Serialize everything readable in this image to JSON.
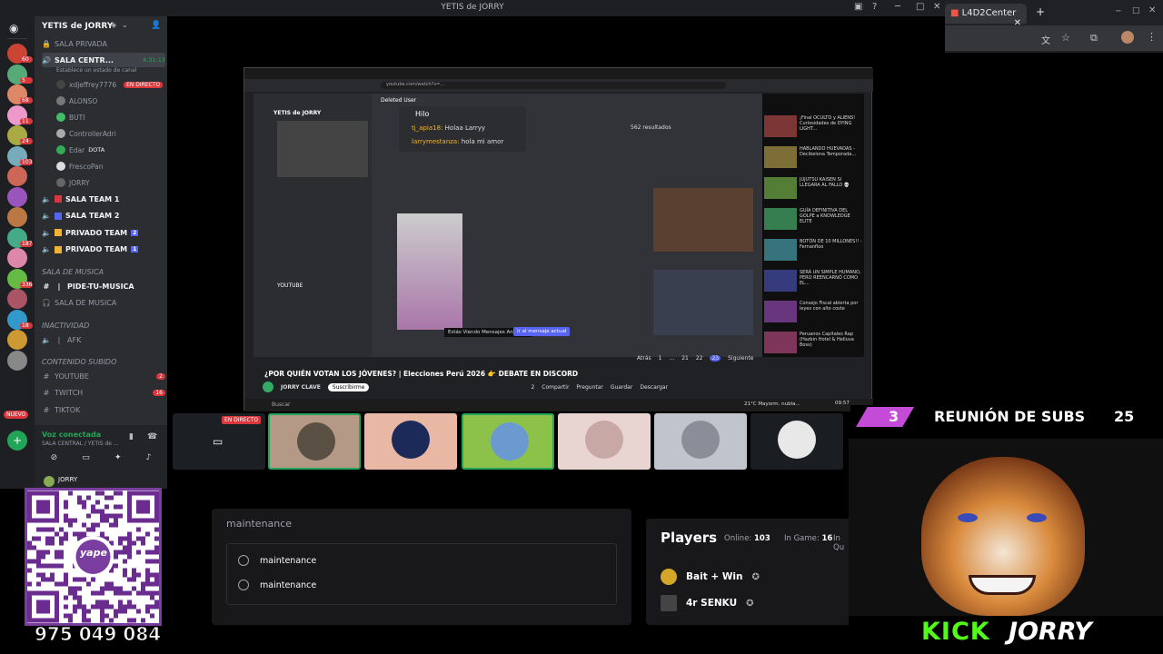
{
  "window": {
    "title": "YETIS de JORRY"
  },
  "chrome": {
    "tab_title": "L4D2Center",
    "new_tab": "+"
  },
  "server": {
    "name": "YETIS de JORRY",
    "nuevo_badge": "NUEVO",
    "server_badges": [
      "60",
      "5",
      "68",
      "11",
      "24",
      "103",
      "",
      "",
      "",
      "187",
      "",
      "336",
      "",
      "18",
      "",
      ""
    ]
  },
  "channels": {
    "top_items": [
      {
        "icon": "🔒",
        "label": "SALA PRIVADA"
      },
      {
        "icon": "🔒",
        "label": "SALA CENTR...",
        "time": "4:31:13",
        "status": "Establece un estado de canal"
      }
    ],
    "voice_users": [
      {
        "name": "xdjeffrey7776",
        "badge": "EN DIRECTO"
      },
      {
        "name": "ALONSO"
      },
      {
        "name": "BUTI"
      },
      {
        "name": "ControllerAdri"
      },
      {
        "name": "Edar",
        "extra": "DOTA"
      },
      {
        "name": "FrescoPan"
      },
      {
        "name": "JORRY"
      }
    ],
    "teams": [
      {
        "label": "SALA TEAM 1"
      },
      {
        "label": "SALA TEAM 2"
      },
      {
        "label": "PRIVADO TEAM",
        "count": "2"
      },
      {
        "label": "PRIVADO TEAM",
        "count": "1"
      }
    ],
    "cat_musica": "SALA DE MUSICA",
    "musica": [
      {
        "label": "PIDE-TU-MUSICA"
      },
      {
        "label": "SALA DE MUSICA"
      }
    ],
    "cat_inact": "INACTIVIDAD",
    "inact": [
      {
        "label": "AFK"
      }
    ],
    "cat_contenido": "CONTENIDO SUBIDO",
    "contenido": [
      {
        "label": "YOUTUBE",
        "count": "2"
      },
      {
        "label": "TWITCH",
        "count": "16"
      },
      {
        "label": "TIKTOK"
      }
    ],
    "voice_connected": "Voz conectada",
    "voice_path": "SALA CENTRAL / YETIS de ...",
    "bottom_user": "JORRY"
  },
  "shared": {
    "url": "youtube.com/watch?v=...",
    "inner_server": "YETIS de JORRY",
    "inner_channel": "YOUTUBE",
    "thread_title": "Hilo",
    "thread_msgs": [
      {
        "user": "tj_apia18:",
        "text": "Holaa Larryy"
      },
      {
        "user": "larrymestanza:",
        "text": "hola mi amor"
      }
    ],
    "deleted_user": "Deleted User",
    "old_msgs": "Estás Viendo Mensajes Antiguos",
    "jump": "Ir al mensaje actual",
    "results": "562 resultados",
    "pagination": [
      "Atrás",
      "1",
      "...",
      "21",
      "22",
      "23",
      "Siguiente"
    ],
    "video_title": "¿POR QUIÉN VOTAN LOS JÓVENES? | Elecciones Perú 2026 👉 DEBATE EN DISCORD",
    "channel": "JORRY CLAVE",
    "subscribe": "Suscribirme",
    "actions": [
      "2",
      "Compartir",
      "Preguntar",
      "Guardar",
      "Descargar"
    ],
    "yt_side": [
      "¡Final OCULTO y ALIENS! Curiosidades de DYING LIGHT...",
      "HABLANDO HUEVADAS - Decibelona Temporada...",
      "JUJUTSU KAISEN SI LLEGARA AL FALLO 💀",
      "GUÍA DEFINITIVA DEL GOLPE a KNOWLEDGE ELITE",
      "BOTÓN DE 10 MILLONES!! - Fernanfloo",
      "SERÁ UN SIMPLE HUMANO, PERO REENCARNÓ COMO EL...",
      "Consejo Fiscal abierta por leyes con alto coste",
      "Peruanos Capitales Rap (Hazbin Hotel & Helluva Boss)"
    ],
    "weather": "21°C Mayorm. nubla...",
    "clock": "09:57"
  },
  "live_badge": "EN DIRECTO",
  "overlay": {
    "subs_count": "3",
    "subs_label": "REUNIÓN DE SUBS",
    "subs_goal": "25",
    "kick": "KICK",
    "kick_name": "JORRY"
  },
  "maintenance": {
    "label": "maintenance",
    "options": [
      "maintenance",
      "maintenance"
    ]
  },
  "players": {
    "title": "Players",
    "online_label": "Online:",
    "online": "103",
    "ingame_label": "In Game:",
    "ingame": "16",
    "queue_label": "In Qu",
    "rows": [
      {
        "name": "Bait + Win"
      },
      {
        "name": "4r SENKU"
      }
    ]
  },
  "yape": {
    "label": "yape",
    "phone": "975 049 084"
  },
  "colors": {
    "discord_bg": "#2b2d31",
    "server_bg": "#1e1f22",
    "live": "#da373c",
    "kick_green": "#53fc18",
    "yape_purple": "#7a3ea0"
  }
}
